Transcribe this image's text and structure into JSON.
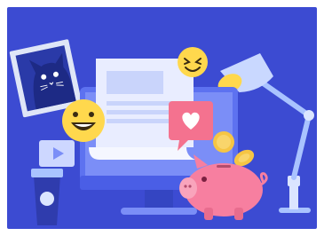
{
  "scene": {
    "background_color": "#3c4bd2",
    "outer_background_color": "#ffffff",
    "elements": [
      {
        "name": "cat-photo-frame",
        "color": "#dfe6f7"
      },
      {
        "name": "desktop-monitor",
        "color": "#5d72f0"
      },
      {
        "name": "document-paper",
        "color": "#e9edff"
      },
      {
        "name": "smiley-emoji-wink",
        "color": "#ffd84d"
      },
      {
        "name": "smiley-emoji-grin",
        "color": "#ffd84d"
      },
      {
        "name": "like-heart-bubble",
        "color": "#f4728f"
      },
      {
        "name": "video-play-card",
        "color": "#cdd7ff"
      },
      {
        "name": "coffee-cup",
        "color": "#2f3cad"
      },
      {
        "name": "gold-coins",
        "color": "#f6c544"
      },
      {
        "name": "piggy-bank",
        "color": "#f77fa0"
      },
      {
        "name": "desk-lamp",
        "color": "#a9c3ff"
      }
    ]
  }
}
